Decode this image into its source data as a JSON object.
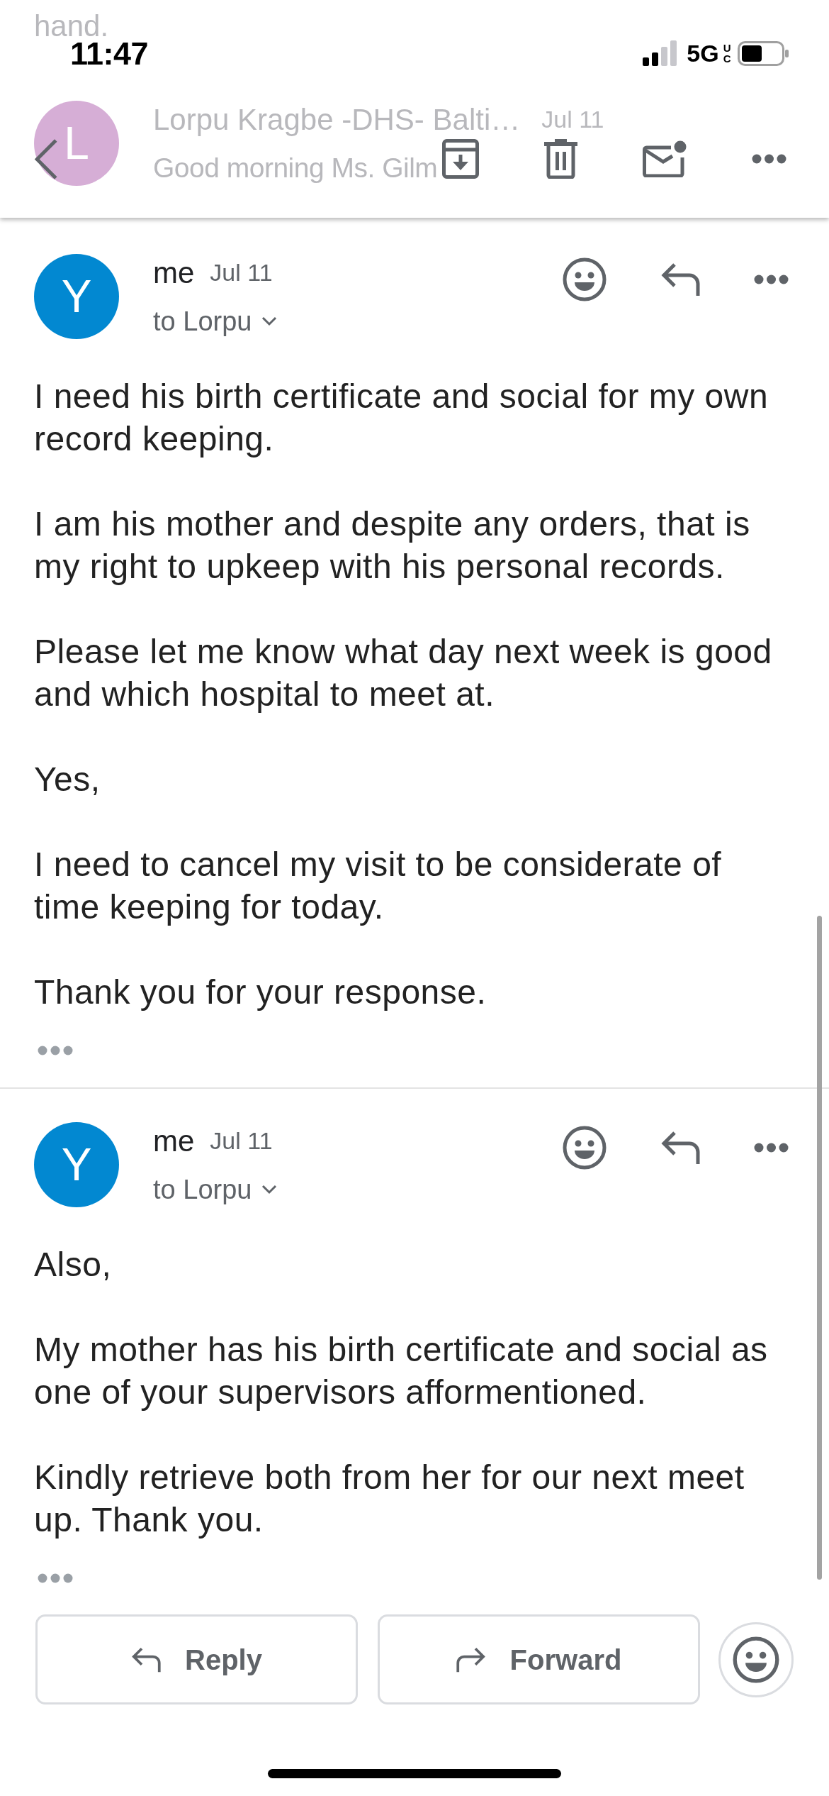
{
  "status_bar": {
    "time": "11:47",
    "network": "5G",
    "network_badge": "UC"
  },
  "background_preview": {
    "above_text": "hand.",
    "avatar_letter": "L",
    "sender": "Lorpu Kragbe -DHS- Balti…",
    "date": "Jul 11",
    "snippet": "Good morning Ms. Gilm"
  },
  "toolbar": [
    {
      "kind": "back"
    },
    {
      "kind": "archive"
    },
    {
      "kind": "delete"
    },
    {
      "kind": "mark_unread"
    },
    {
      "kind": "more"
    }
  ],
  "messages": [
    {
      "avatar_letter": "Y",
      "sender": "me",
      "date": "Jul 11",
      "recipient": "to Lorpu",
      "paragraphs": [
        "I need his birth certificate and social for my own record keeping.",
        "I am his mother and despite any orders, that is my right to upkeep with his personal records.",
        "Please let me know what day next week is good and which hospital to meet at.",
        "Yes,",
        "I need to cancel my visit to be considerate of time keeping for today.",
        "Thank you for your response."
      ]
    },
    {
      "avatar_letter": "Y",
      "sender": "me",
      "date": "Jul 11",
      "recipient": "to Lorpu",
      "paragraphs": [
        "Also,",
        "My mother has his birth certificate and social as one of your supervisors afformentioned.",
        "Kindly retrieve both from her for our next meet up. Thank you."
      ]
    }
  ],
  "actions": [
    {
      "kind": "reply",
      "label": "Reply"
    },
    {
      "kind": "forward",
      "label": "Forward"
    },
    {
      "kind": "react"
    }
  ]
}
